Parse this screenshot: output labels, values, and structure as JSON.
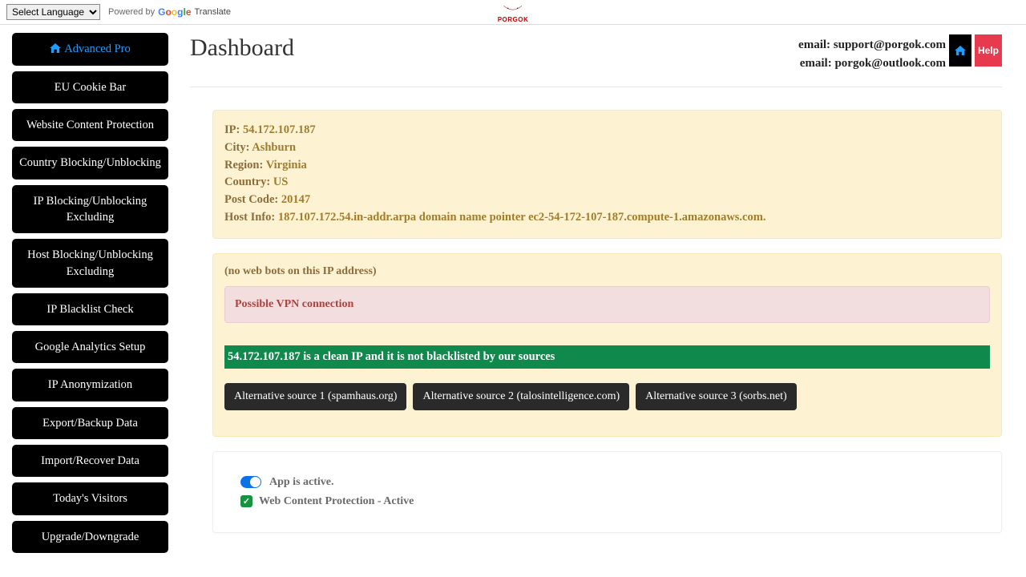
{
  "topbar": {
    "language_select": "Select Language",
    "powered_by": "Powered by",
    "translate": "Translate",
    "brand": "PORGOK"
  },
  "sidebar": [
    "Advanced Pro",
    "EU Cookie Bar",
    "Website Content Protection",
    "Country Blocking/Unblocking",
    "IP Blocking/Unblocking Excluding",
    "Host Blocking/Unblocking Excluding",
    "IP Blacklist Check",
    "Google Analytics Setup",
    "IP Anonymization",
    "Export/Backup Data",
    "Import/Recover Data",
    "Today's Visitors",
    "Upgrade/Downgrade"
  ],
  "header": {
    "title": "Dashboard",
    "email1": "email: support@porgok.com",
    "email2": "email: porgok@outlook.com",
    "help": "Help"
  },
  "ipinfo": {
    "ip_label": "IP: ",
    "ip": "54.172.107.187",
    "city_label": "City: ",
    "city": "Ashburn",
    "region_label": "Region: ",
    "region": "Virginia",
    "country_label": "Country: ",
    "country": "US",
    "post_label": "Post Code: ",
    "post": "20147",
    "host_label": "Host Info: ",
    "host": "187.107.172.54.in-addr.arpa domain name pointer ec2-54-172-107-187.compute-1.amazonaws.com."
  },
  "bots": {
    "none": "(no web bots on this IP address)",
    "vpn": "Possible VPN connection",
    "clean": "54.172.107.187 is a clean IP and it is not blacklisted by our sources",
    "src1": "Alternative source 1 (spamhaus.org)",
    "src2": "Alternative source 2 (talosintelligence.com)",
    "src3": "Alternative source 3 (sorbs.net)"
  },
  "status": {
    "active": "App is active.",
    "wcp": "Web Content Protection - Active"
  }
}
